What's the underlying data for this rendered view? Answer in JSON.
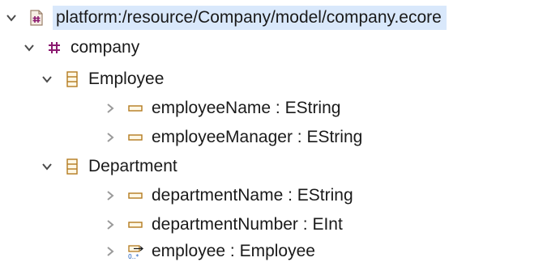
{
  "tree": {
    "root": {
      "label": "platform:/resource/Company/model/company.ecore",
      "icon": "ecore-resource-icon",
      "expanded": true
    },
    "package": {
      "label": "company",
      "icon": "epackage-icon",
      "expanded": true
    },
    "classes": [
      {
        "label": "Employee",
        "icon": "eclass-icon",
        "expanded": true,
        "features": [
          {
            "name": "employeeName",
            "type": "EString",
            "icon": "eattribute-icon"
          },
          {
            "name": "employeeManager",
            "type": "EString",
            "icon": "eattribute-icon"
          }
        ]
      },
      {
        "label": "Department",
        "icon": "eclass-icon",
        "expanded": true,
        "features": [
          {
            "name": "departmentName",
            "type": "EString",
            "icon": "eattribute-icon"
          },
          {
            "name": "departmentNumber",
            "type": "EInt",
            "icon": "eattribute-icon"
          },
          {
            "name": "employee",
            "type": "Employee",
            "icon": "ereference-many-icon",
            "multiplicity": "0..*"
          }
        ]
      }
    ],
    "separator": " : "
  }
}
